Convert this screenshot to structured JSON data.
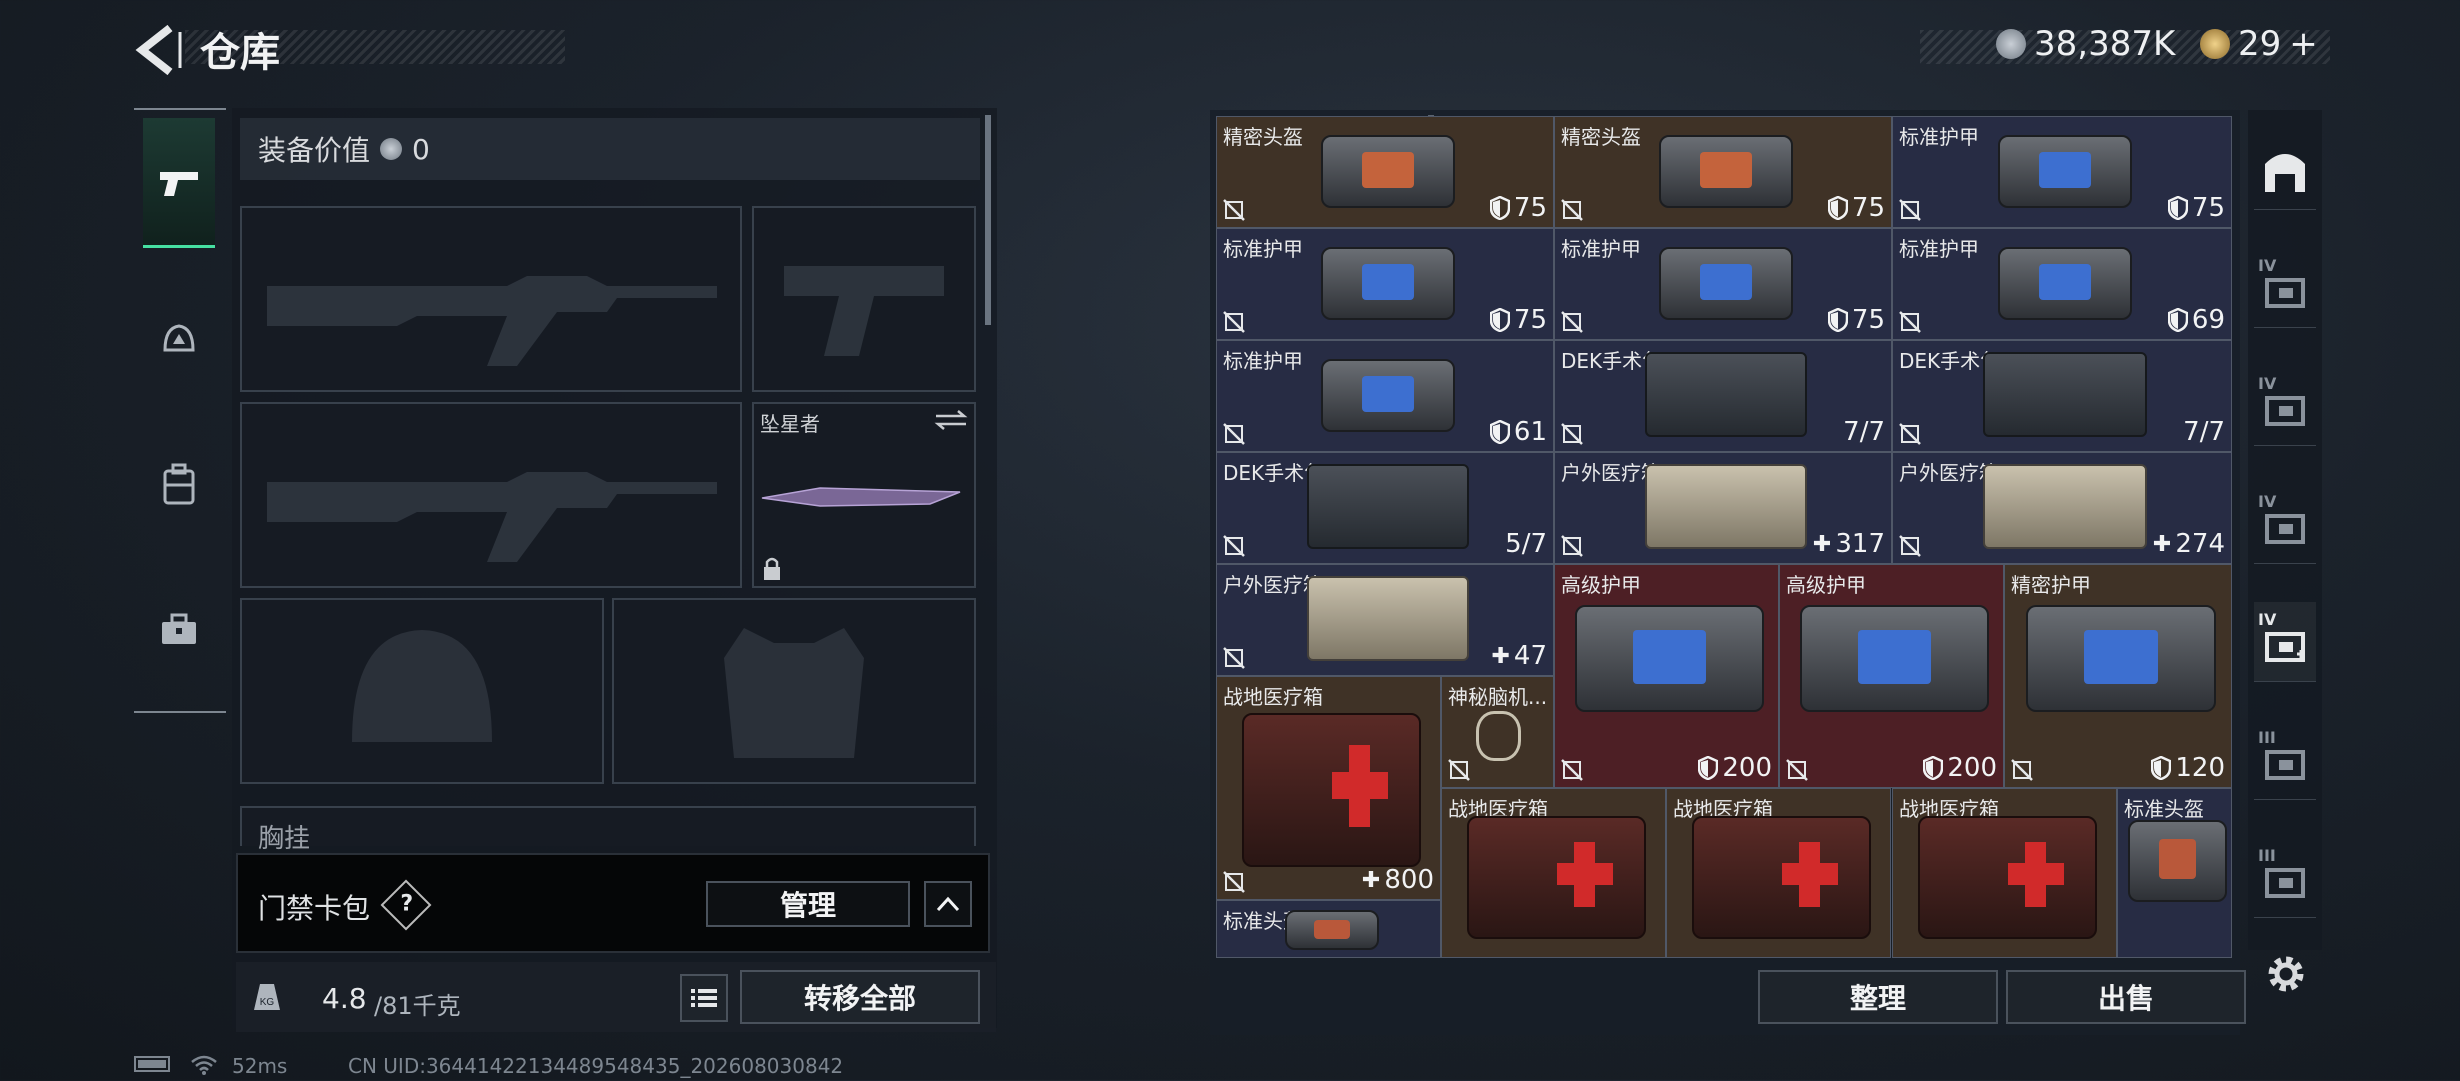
{
  "header": {
    "title": "仓库",
    "currency": [
      {
        "icon": "silver-coin-icon",
        "value": "38,387K",
        "color": "#9aa4ae"
      },
      {
        "icon": "gold-coin-icon",
        "value": "29",
        "suffix": "+",
        "color": "#c9a55b"
      }
    ]
  },
  "equipment": {
    "value_label": "装备价值",
    "value": "0",
    "slots": [
      {
        "name": "primary-weapon-1",
        "label": ""
      },
      {
        "name": "pistol",
        "label": ""
      },
      {
        "name": "primary-weapon-2",
        "label": ""
      },
      {
        "name": "melee",
        "label": "坠星者"
      },
      {
        "name": "helmet",
        "label": ""
      },
      {
        "name": "armor",
        "label": ""
      }
    ],
    "chest_label": "胸挂"
  },
  "keycard_bag": {
    "label": "门禁卡包",
    "help": "?",
    "manage": "管理"
  },
  "weight": {
    "current": "4.8",
    "max": "/81千克",
    "transfer_all": "转移全部"
  },
  "inventory": {
    "items": [
      {
        "name": "精密头盔",
        "count": "75",
        "type": "armor",
        "insurable": false,
        "bg": "brown"
      },
      {
        "name": "精密头盔",
        "count": "75",
        "type": "armor",
        "insurable": false,
        "bg": "brown"
      },
      {
        "name": "标准护甲",
        "count": "75",
        "type": "armor",
        "insurable": false,
        "bg": "navy"
      },
      {
        "name": "标准护甲",
        "count": "75",
        "type": "armor",
        "insurable": false,
        "bg": "navy"
      },
      {
        "name": "标准护甲",
        "count": "75",
        "type": "armor",
        "insurable": false,
        "bg": "navy"
      },
      {
        "name": "标准护甲",
        "count": "69",
        "type": "armor",
        "insurable": false,
        "bg": "navy"
      },
      {
        "name": "标准护甲",
        "count": "61",
        "type": "armor",
        "insurable": false,
        "bg": "navy"
      },
      {
        "name": "DEK手术包",
        "count": "7/7",
        "type": "kit",
        "insurable": false,
        "bg": "navy"
      },
      {
        "name": "DEK手术包",
        "count": "7/7",
        "type": "kit",
        "insurable": false,
        "bg": "navy"
      },
      {
        "name": "DEK手术包",
        "count": "5/7",
        "type": "kit",
        "insurable": false,
        "bg": "navy"
      },
      {
        "name": "户外医疗箱",
        "count": "317",
        "type": "heal",
        "insurable": false,
        "bg": "navy"
      },
      {
        "name": "户外医疗箱",
        "count": "274",
        "type": "heal",
        "insurable": false,
        "bg": "navy"
      },
      {
        "name": "户外医疗箱",
        "count": "47",
        "type": "heal",
        "insurable": false,
        "bg": "navy"
      },
      {
        "name": "高级护甲",
        "count": "200",
        "type": "armor",
        "insurable": false,
        "bg": "red"
      },
      {
        "name": "高级护甲",
        "count": "200",
        "type": "armor",
        "insurable": false,
        "bg": "red"
      },
      {
        "name": "精密护甲",
        "count": "120",
        "type": "armor",
        "insurable": false,
        "bg": "brown"
      },
      {
        "name": "战地医疗箱",
        "count": "800",
        "type": "heal",
        "insurable": false,
        "bg": "brown"
      },
      {
        "name": "神秘脑机...",
        "count": "",
        "type": "none",
        "insurable": false,
        "bg": "brown"
      },
      {
        "name": "战地医疗箱",
        "count": "",
        "type": "none",
        "insurable": true,
        "bg": "brown"
      },
      {
        "name": "战地医疗箱",
        "count": "",
        "type": "none",
        "insurable": true,
        "bg": "brown"
      },
      {
        "name": "战地医疗箱",
        "count": "",
        "type": "none",
        "insurable": true,
        "bg": "brown"
      },
      {
        "name": "标准头盔",
        "count": "",
        "type": "none",
        "insurable": true,
        "bg": "navy"
      },
      {
        "name": "标准头盔",
        "count": "",
        "type": "none",
        "insurable": true,
        "bg": "navy"
      }
    ],
    "sort_button": "整理",
    "sell_button": "出售"
  },
  "side_tabs": [
    {
      "icon": "warehouse-icon",
      "level": ""
    },
    {
      "icon": "storage-box-icon",
      "level": "IV"
    },
    {
      "icon": "storage-box-icon",
      "level": "IV"
    },
    {
      "icon": "safe-box-icon",
      "level": "IV"
    },
    {
      "icon": "medical-box-icon",
      "level": "IV"
    },
    {
      "icon": "weapon-box-icon",
      "level": "III"
    },
    {
      "icon": "weapon-box-icon",
      "level": "III"
    }
  ],
  "footer": {
    "ping": "52ms",
    "uid": "CN UID:3644142213448954843​5_202608030842"
  },
  "colors": {
    "accent": "#46e0a2",
    "navy_cell": "#272c44",
    "brown_cell": "#3f3226",
    "red_cell": "#4d1f25"
  }
}
